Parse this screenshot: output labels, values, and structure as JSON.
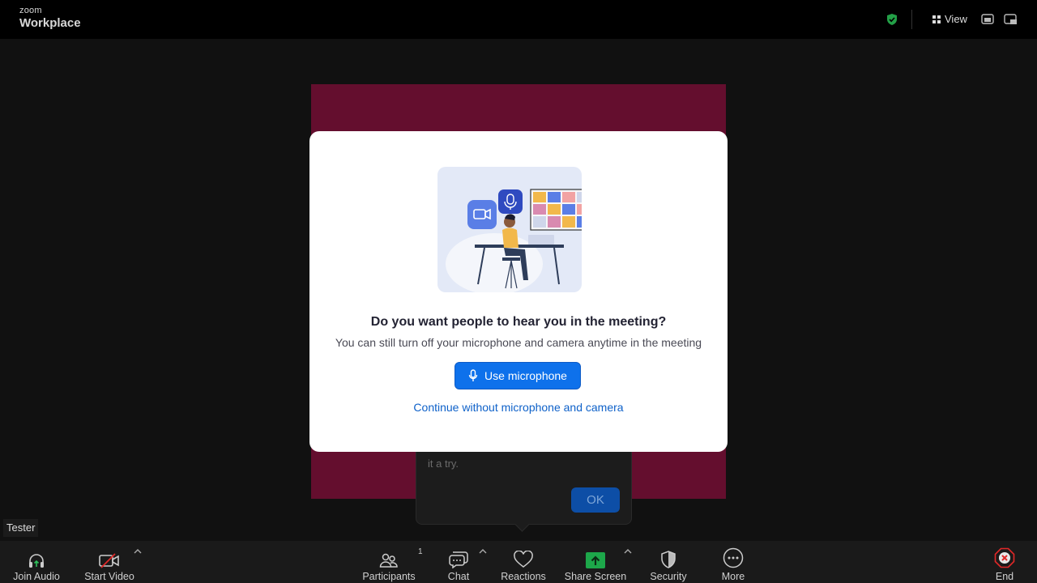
{
  "brand": {
    "line1": "zoom",
    "line2": "Workplace"
  },
  "topbar": {
    "view_label": "View"
  },
  "tooltip": {
    "text": "it a try.",
    "ok_label": "OK"
  },
  "participant": {
    "name": "Tester"
  },
  "toolbar": {
    "join_audio": "Join Audio",
    "start_video": "Start Video",
    "participants": "Participants",
    "participants_count": "1",
    "chat": "Chat",
    "reactions": "Reactions",
    "share_screen": "Share Screen",
    "security": "Security",
    "more": "More",
    "end": "End"
  },
  "dialog": {
    "title": "Do you want people to hear you in the meeting?",
    "subtitle": "You can still turn off your microphone and camera anytime in the meeting",
    "primary_button": "Use microphone",
    "secondary_link": "Continue without microphone and camera"
  },
  "colors": {
    "stage": "#640e2e",
    "accent": "#0e71eb",
    "link": "#0e61c9",
    "share_green": "#1da74a",
    "end_red": "#e02828",
    "secure_green": "#23a047"
  },
  "icons": [
    "shield-check-icon",
    "grid-view-icon",
    "picture-in-picture-icon",
    "minimize-icon",
    "headphones-icon",
    "video-off-icon",
    "participants-icon",
    "chat-icon",
    "heart-icon",
    "share-screen-icon",
    "security-shield-icon",
    "more-icon",
    "end-icon",
    "microphone-icon"
  ]
}
